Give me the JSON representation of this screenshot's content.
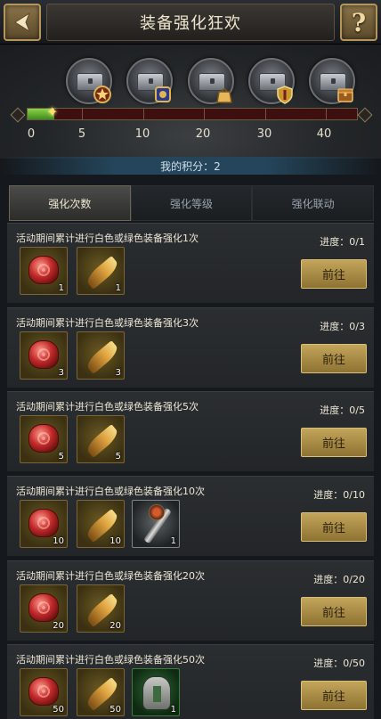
{
  "header": {
    "title": "装备强化狂欢",
    "back_icon": "back-arrow-icon",
    "help_label": "?"
  },
  "rewards": {
    "milestones": [
      "0",
      "5",
      "10",
      "20",
      "30",
      "40"
    ],
    "progress_fraction": 0.08,
    "chest_items": [
      "star-medal",
      "crest-badge",
      "gift-bag",
      "shield-emblem",
      "treasure-crate"
    ]
  },
  "score": {
    "label": "我的积分：2"
  },
  "tabs": [
    {
      "label": "强化次数",
      "active": true
    },
    {
      "label": "强化等级",
      "active": false
    },
    {
      "label": "强化联动",
      "active": false
    }
  ],
  "tasks": [
    {
      "desc": "活动期间累计进行白色或绿色装备强化1次",
      "progress": "进度：0/1",
      "button": "前往",
      "rewards": [
        {
          "icon": "red-gem-icon",
          "qty": "1"
        },
        {
          "icon": "horn-icon",
          "qty": "1"
        }
      ]
    },
    {
      "desc": "活动期间累计进行白色或绿色装备强化3次",
      "progress": "进度：0/3",
      "button": "前往",
      "rewards": [
        {
          "icon": "red-gem-icon",
          "qty": "3"
        },
        {
          "icon": "horn-icon",
          "qty": "3"
        }
      ]
    },
    {
      "desc": "活动期间累计进行白色或绿色装备强化5次",
      "progress": "进度：0/5",
      "button": "前往",
      "rewards": [
        {
          "icon": "red-gem-icon",
          "qty": "5"
        },
        {
          "icon": "horn-icon",
          "qty": "5"
        }
      ]
    },
    {
      "desc": "活动期间累计进行白色或绿色装备强化10次",
      "progress": "进度：0/10",
      "button": "前往",
      "rewards": [
        {
          "icon": "red-gem-icon",
          "qty": "10"
        },
        {
          "icon": "horn-icon",
          "qty": "10"
        },
        {
          "icon": "scepter-icon",
          "qty": "1"
        }
      ]
    },
    {
      "desc": "活动期间累计进行白色或绿色装备强化20次",
      "progress": "进度：0/20",
      "button": "前往",
      "rewards": [
        {
          "icon": "red-gem-icon",
          "qty": "20"
        },
        {
          "icon": "horn-icon",
          "qty": "20"
        }
      ]
    },
    {
      "desc": "活动期间累计进行白色或绿色装备强化50次",
      "progress": "进度：0/50",
      "button": "前往",
      "rewards": [
        {
          "icon": "red-gem-icon",
          "qty": "50"
        },
        {
          "icon": "horn-icon",
          "qty": "50"
        },
        {
          "icon": "armor-icon",
          "qty": "1"
        }
      ]
    }
  ]
}
